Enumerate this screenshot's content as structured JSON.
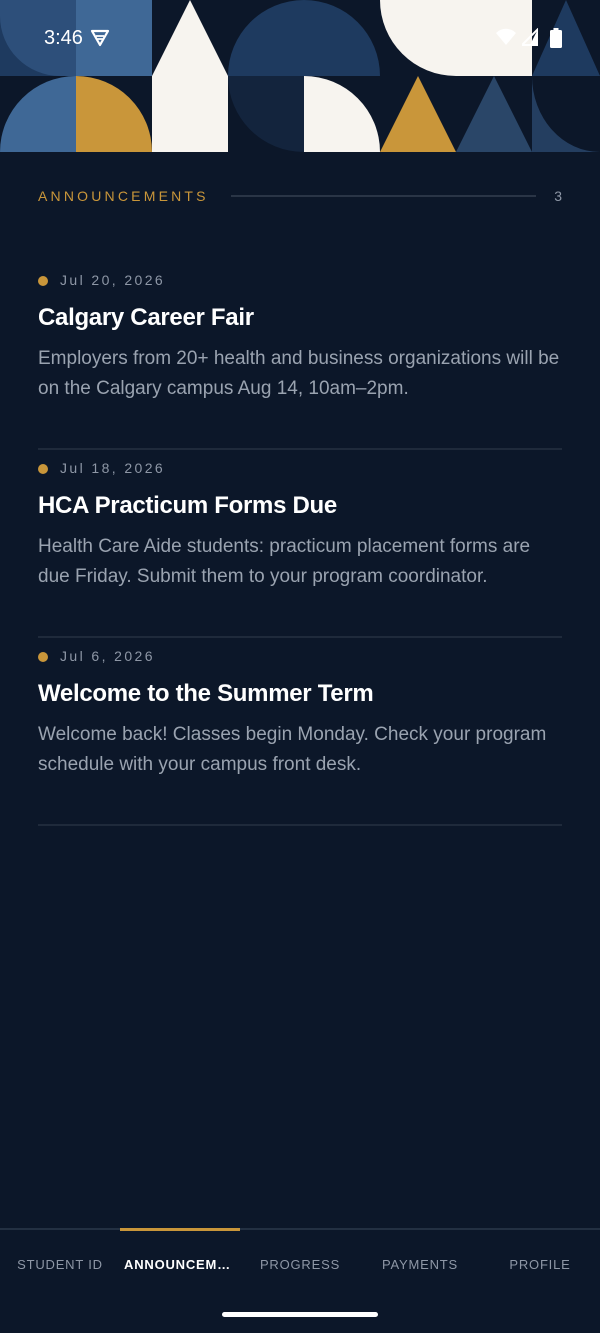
{
  "status_bar": {
    "time": "3:46",
    "icons": [
      "vpn-icon",
      "wifi-icon",
      "signal-icon",
      "battery-icon"
    ]
  },
  "colors": {
    "background": "#0c1729",
    "accent_gold": "#c9963a",
    "navy_mid": "#1e3a5f",
    "steel_blue": "#3f6896",
    "cream": "#f7f4ef",
    "muted_text": "#8e97a6"
  },
  "section": {
    "title": "ANNOUNCEMENTS",
    "count": "3"
  },
  "announcements": [
    {
      "date": "Jul 20, 2026",
      "title": "Calgary Career Fair",
      "body": "Employers from 20+ health and business organizations will be on the Calgary campus Aug 14, 10am–2pm."
    },
    {
      "date": "Jul 18, 2026",
      "title": "HCA Practicum Forms Due",
      "body": "Health Care Aide students: practicum placement forms are due Friday. Submit them to your program coordinator."
    },
    {
      "date": "Jul 6, 2026",
      "title": "Welcome to the Summer Term",
      "body": "Welcome back! Classes begin Monday. Check your program schedule with your campus front desk."
    }
  ],
  "nav": {
    "tabs": [
      {
        "label": "STUDENT ID"
      },
      {
        "label": "ANNOUNCEME..."
      },
      {
        "label": "PROGRESS"
      },
      {
        "label": "PAYMENTS"
      },
      {
        "label": "PROFILE"
      }
    ],
    "active_index": 1
  }
}
